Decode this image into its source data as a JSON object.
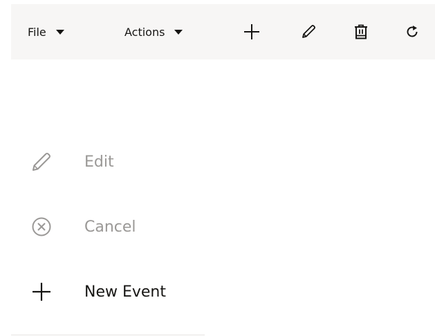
{
  "toolbar": {
    "file_label": "File",
    "actions_label": "Actions",
    "icons": {
      "add": "plus-icon",
      "edit": "pencil-icon",
      "delete": "trash-icon",
      "refresh": "refresh-icon"
    }
  },
  "menu": {
    "items": [
      {
        "label": "Edit",
        "icon": "pencil-icon",
        "enabled": false
      },
      {
        "label": "Cancel",
        "icon": "circle-x-icon",
        "enabled": false
      },
      {
        "label": "New Event",
        "icon": "plus-icon",
        "enabled": true
      }
    ]
  },
  "colors": {
    "toolbar_bg": "#f7f6f5",
    "text": "#161513",
    "disabled": "#9a9896"
  }
}
